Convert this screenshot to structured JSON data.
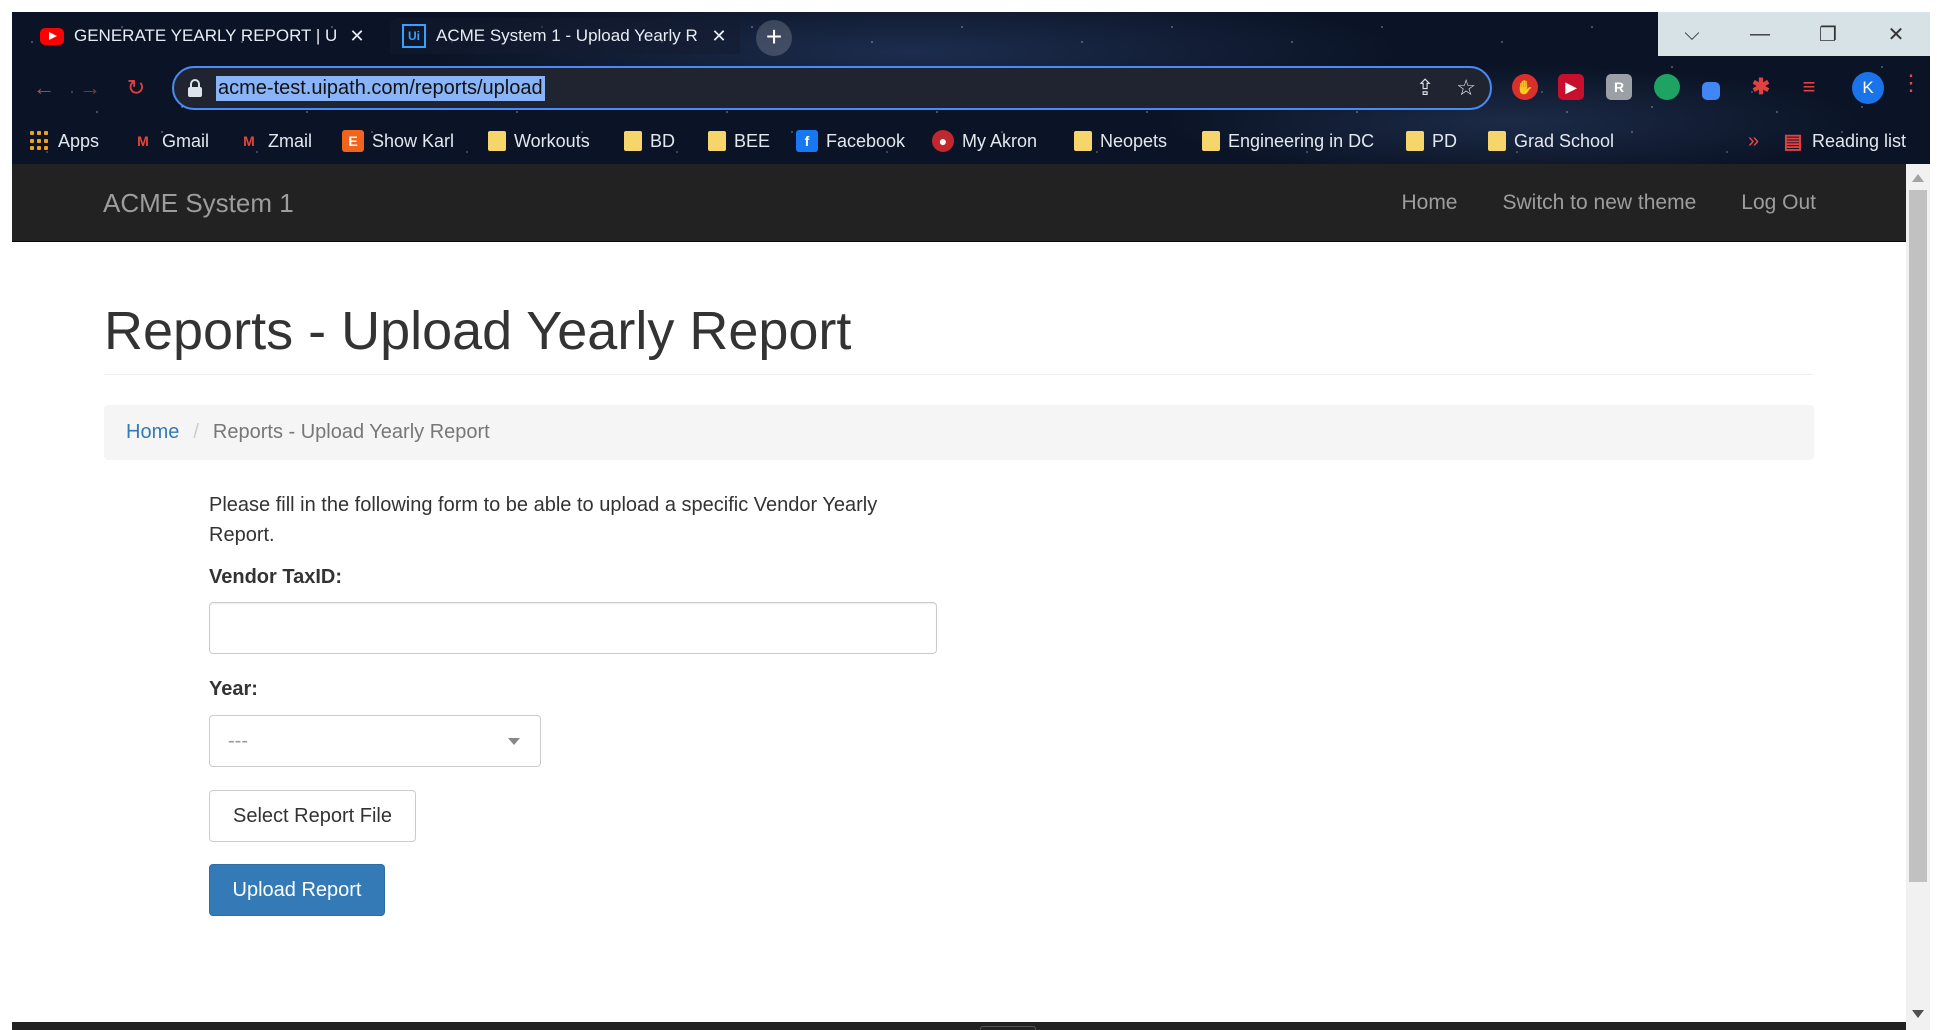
{
  "browser": {
    "tabs": [
      {
        "title": "GENERATE YEARLY REPORT | UiP",
        "icon": "youtube-icon",
        "active": false
      },
      {
        "title": "ACME System 1 - Upload Yearly R",
        "icon": "uipath-icon",
        "active": true
      }
    ],
    "new_tab_symbol": "+",
    "window_controls": {
      "dropdown": "⌵",
      "minimize": "—",
      "restore": "❐",
      "close": "✕"
    },
    "url": "acme-test.uipath.com/reports/upload",
    "profile_initial": "K",
    "bookmarks": [
      {
        "label": "Apps",
        "icon": "apps-grid-icon"
      },
      {
        "label": "Gmail",
        "icon": "gmail-icon"
      },
      {
        "label": "Zmail",
        "icon": "gmail-icon"
      },
      {
        "label": "Show Karl",
        "icon": "etsy-icon"
      },
      {
        "label": "Workouts",
        "icon": "folder-icon"
      },
      {
        "label": "BD",
        "icon": "folder-icon"
      },
      {
        "label": "BEE",
        "icon": "folder-icon"
      },
      {
        "label": "Facebook",
        "icon": "facebook-icon"
      },
      {
        "label": "My Akron",
        "icon": "akron-icon"
      },
      {
        "label": "Neopets",
        "icon": "folder-icon"
      },
      {
        "label": "Engineering in DC",
        "icon": "folder-icon"
      },
      {
        "label": "PD",
        "icon": "folder-icon"
      },
      {
        "label": "Grad School",
        "icon": "folder-icon"
      }
    ],
    "more_bookmarks": "»",
    "reading_list": "Reading list"
  },
  "navbar": {
    "brand": "ACME System 1",
    "links": [
      "Home",
      "Switch to new theme",
      "Log Out"
    ]
  },
  "page": {
    "title": "Reports - Upload Yearly Report",
    "breadcrumb": {
      "home": "Home",
      "separator": "/",
      "current": "Reports - Upload Yearly Report"
    },
    "intro": "Please fill in the following form to be able to upload a specific Vendor Yearly Report.",
    "vendor_label": "Vendor TaxID:",
    "vendor_value": "",
    "year_label": "Year:",
    "year_selected": "---",
    "select_file_label": "Select Report File",
    "upload_label": "Upload Report"
  },
  "colors": {
    "navbar_bg": "#222222",
    "link": "#337ab7",
    "primary_button": "#337ab7"
  }
}
